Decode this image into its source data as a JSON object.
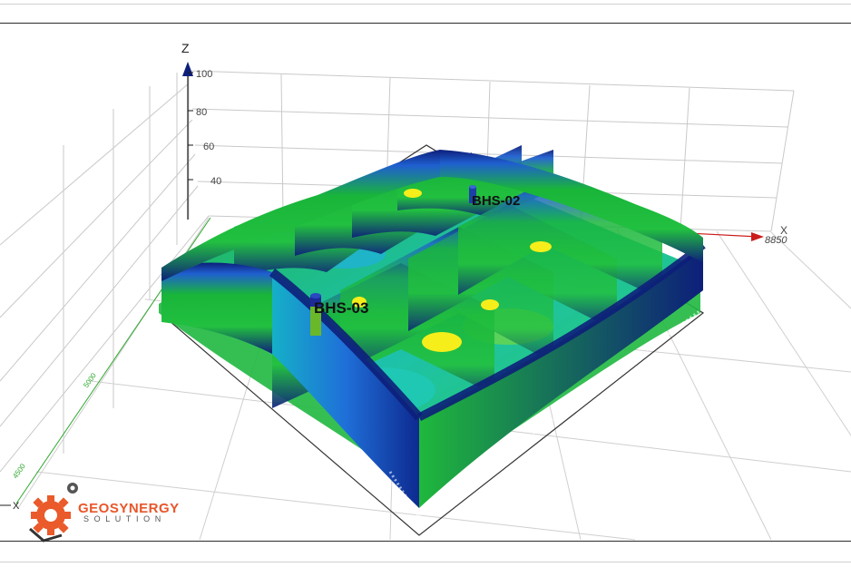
{
  "axes": {
    "z_label": "Z",
    "x_label": "X",
    "x_left_label": "X",
    "z_ticks": [
      "100",
      "80",
      "60",
      "40"
    ],
    "x_tick_far": "500",
    "x_tick_end": "8850"
  },
  "boreholes": [
    {
      "name": "BHS-02"
    },
    {
      "name": "BHS-03"
    }
  ],
  "logo": {
    "line1": "GEOSYNERGY",
    "line2": "SOLUTION"
  },
  "colors": {
    "deep_blue": "#0d1f7a",
    "blue": "#1f5fd0",
    "cyan": "#1bb8d6",
    "green": "#19b53a",
    "light_green": "#63d34a",
    "yellow": "#f5ee1a",
    "x_axis_red": "#cc1b1b",
    "grid_green": "#2fa82f",
    "logo_orange": "#e8562a"
  }
}
